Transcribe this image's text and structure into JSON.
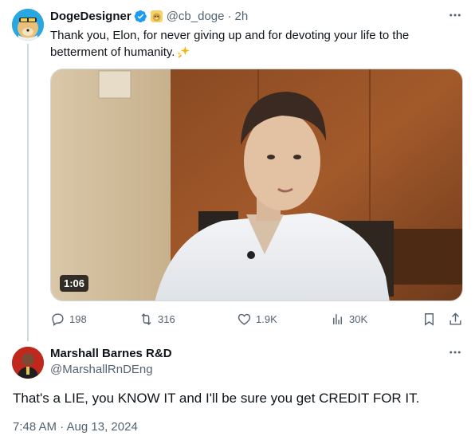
{
  "original_tweet": {
    "display_name": "DogeDesigner",
    "handle": "@cb_doge",
    "separator": "·",
    "time_ago": "2h",
    "text": "Thank you, Elon, for never giving up and for devoting your life to the betterment of humanity.",
    "video_duration": "1:06",
    "stats": {
      "replies": "198",
      "reposts": "316",
      "likes": "1.9K",
      "views": "30K"
    }
  },
  "reply": {
    "display_name": "Marshall Barnes R&D",
    "handle": "@MarshallRnDEng",
    "text": "That's a LIE, you KNOW IT and I'll be sure you get CREDIT FOR IT.",
    "timestamp": "7:48 AM · Aug 13, 2024"
  },
  "colors": {
    "accent_blue": "#1d9bf0",
    "secondary_text": "#536471",
    "primary_text": "#0f1419",
    "divider": "#cfd9de"
  },
  "icons": [
    "verified-badge-icon",
    "doge-badge-icon",
    "more-icon",
    "reply-icon",
    "repost-icon",
    "like-icon",
    "views-icon",
    "bookmark-icon",
    "share-icon",
    "sparkle-emoji-icon"
  ]
}
